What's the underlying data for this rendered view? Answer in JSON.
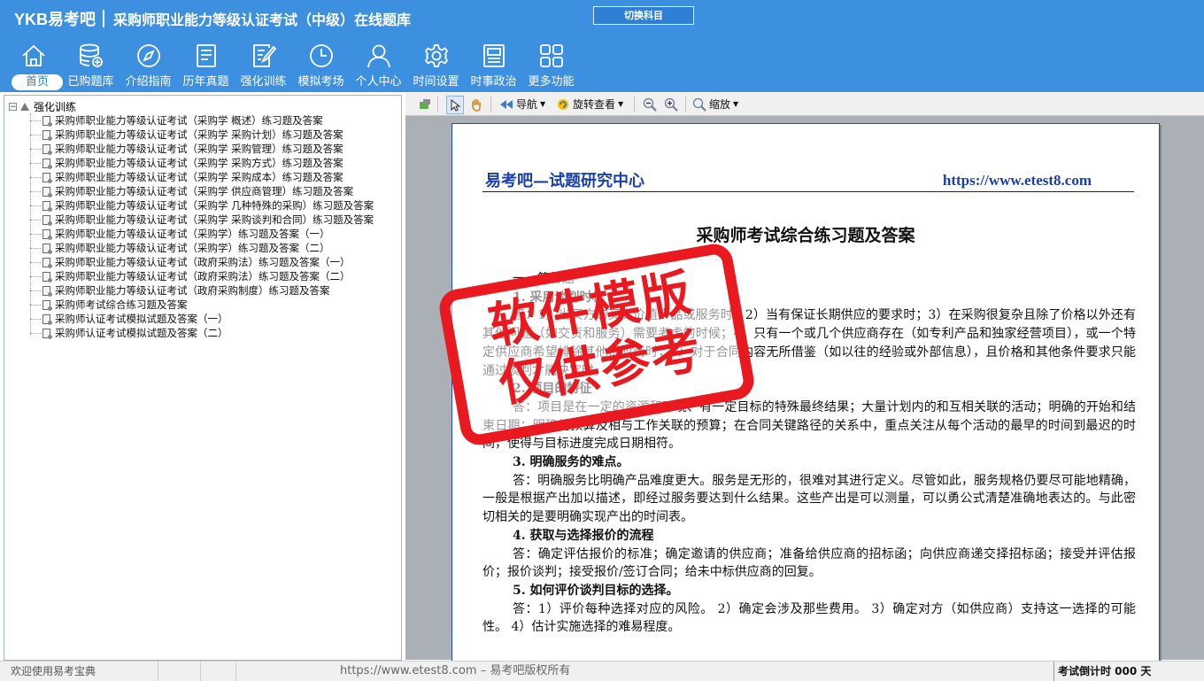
{
  "app": {
    "logo": "YKB易考吧",
    "title": "采购师职业能力等级认证考试（中级）在线题库",
    "switch_button": "切换科目"
  },
  "nav": [
    {
      "label": "首页",
      "icon": "home-icon"
    },
    {
      "label": "已购题库",
      "icon": "database-icon"
    },
    {
      "label": "介绍指南",
      "icon": "compass-icon"
    },
    {
      "label": "历年真题",
      "icon": "list-doc-icon"
    },
    {
      "label": "强化训练",
      "icon": "edit-doc-icon"
    },
    {
      "label": "模拟考场",
      "icon": "clock-icon"
    },
    {
      "label": "个人中心",
      "icon": "user-icon"
    },
    {
      "label": "时间设置",
      "icon": "gear-icon"
    },
    {
      "label": "时事政治",
      "icon": "news-icon"
    },
    {
      "label": "更多功能",
      "icon": "grid-icon"
    }
  ],
  "tree": {
    "root": "强化训练",
    "toggle": "−",
    "items": [
      "采购师职业能力等级认证考试（采购学 概述）练习题及答案",
      "采购师职业能力等级认证考试（采购学 采购计划）练习题及答案",
      "采购师职业能力等级认证考试（采购学 采购管理）练习题及答案",
      "采购师职业能力等级认证考试（采购学 采购方式）练习题及答案",
      "采购师职业能力等级认证考试（采购学 采购成本）练习题及答案",
      "采购师职业能力等级认证考试（采购学 供应商管理）练习题及答案",
      "采购师职业能力等级认证考试（采购学 几种特殊的采购）练习题及答案",
      "采购师职业能力等级认证考试（采购学 采购谈判和合同）练习题及答案",
      "采购师职业能力等级认证考试（采购学）练习题及答案（一）",
      "采购师职业能力等级认证考试（采购学）练习题及答案（二）",
      "采购师职业能力等级认证考试（政府采购法）练习题及答案（一）",
      "采购师职业能力等级认证考试（政府采购法）练习题及答案（二）",
      "采购师职业能力等级认证考试（政府采购制度）练习题及答案",
      "采购师考试综合练习题及答案",
      "采购师认证考试模拟试题及答案（一）",
      "采购师认证考试模拟试题及答案（二）"
    ]
  },
  "toolbar": {
    "nav_label": "导航",
    "rotate_label": "旋转查看",
    "zoom_label": "缩放"
  },
  "document": {
    "header_left": "易考吧—试题研究中心",
    "header_right": "https://www.etest8.com",
    "title": "采购师考试综合练习题及答案",
    "section": "一、简答题",
    "paragraphs": [
      {
        "type": "q",
        "text": "1. 采用谈判时机"
      },
      {
        "type": "a",
        "text": "答：1）当买方购买高价值产品或服务时；2）当有保证长期供应的要求时；3）在采购很复杂且除了价格以外还有其他问题（如交货和服务）需要考虑的时候；4）只有一个或几个供应商存在（如专利产品和独家经营项目），或一个特定供应商希望排除其他供应商时；5）对于合同内容无所借鉴（如以往的经验或外部信息），且价格和其他条件要求只能通过谈判才能决定时。"
      },
      {
        "type": "q",
        "text": "2. 项目的特征"
      },
      {
        "type": "a",
        "text": "答：项目是在一定的资源和环境、有一定目标的特殊最终结果；大量计划内的和互相关联的活动；明确的开始和结束日期；明确的预算及相与工作关联的预算；在合同关键路径的关系中，重点关注从每个活动的最早的时间到最迟的时间，使得与目标进度完成日期相符。"
      },
      {
        "type": "q",
        "text": "3. 明确服务的难点。"
      },
      {
        "type": "a",
        "text": "答：明确服务比明确产品难度更大。服务是无形的，很难对其进行定义。尽管如此，服务规格仍要尽可能地精确，一般是根据产出加以描述，即经过服务要达到什么结果。这些产出是可以测量，可以勇公式清楚准确地表达的。与此密切相关的是要明确实现产出的时间表。"
      },
      {
        "type": "q",
        "text": "4. 获取与选择报价的流程"
      },
      {
        "type": "a",
        "text": "答：确定评估报价的标准；确定邀请的供应商；准备给供应商的招标函；向供应商递交择招标函；接受并评估报价；报价谈判；接受报价/签订合同；给未中标供应商的回复。"
      },
      {
        "type": "q",
        "text": "5. 如何评价谈判目标的选择。"
      },
      {
        "type": "a",
        "text": "答：1）评价每种选择对应的风险。 2）确定会涉及那些费用。 3）确定对方（如供应商）支持这一选择的可能性。 4）估计实施选择的难易程度。"
      }
    ]
  },
  "stamp": {
    "line1": "软件模版",
    "line2": "仅供参考",
    "color": "#e9191f"
  },
  "status": {
    "welcome": "欢迎使用易考宝典",
    "copyright": "https://www.etest8.com – 易考吧版权所有",
    "countdown": "考试倒计时 000 天"
  }
}
